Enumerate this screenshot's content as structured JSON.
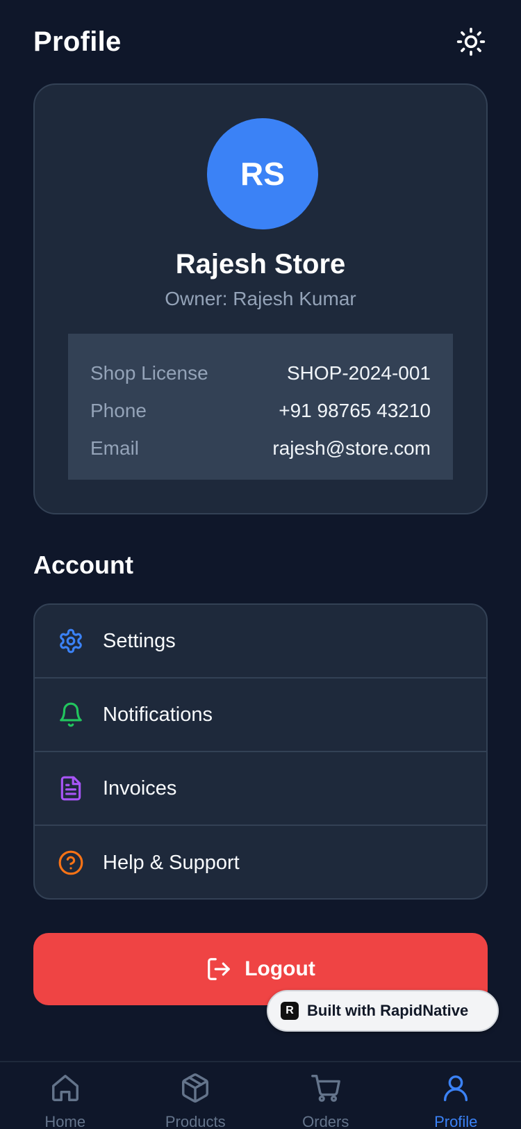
{
  "header": {
    "title": "Profile",
    "theme_icon": "sun-icon"
  },
  "profile": {
    "initials": "RS",
    "store_name": "Rajesh Store",
    "owner": "Owner: Rajesh Kumar",
    "details": [
      {
        "label": "Shop License",
        "value": "SHOP-2024-001"
      },
      {
        "label": "Phone",
        "value": "+91 98765 43210"
      },
      {
        "label": "Email",
        "value": "rajesh@store.com"
      }
    ]
  },
  "account": {
    "title": "Account",
    "items": [
      {
        "label": "Settings",
        "icon": "gear-icon",
        "color": "#3b82f6"
      },
      {
        "label": "Notifications",
        "icon": "bell-icon",
        "color": "#22c55e"
      },
      {
        "label": "Invoices",
        "icon": "document-icon",
        "color": "#a855f7"
      },
      {
        "label": "Help & Support",
        "icon": "help-circle-icon",
        "color": "#f97316"
      }
    ]
  },
  "logout": {
    "label": "Logout",
    "icon": "logout-icon"
  },
  "badge": {
    "label": "Built with RapidNative"
  },
  "bottom_nav": {
    "items": [
      {
        "label": "Home",
        "icon": "home-icon",
        "active": false
      },
      {
        "label": "Products",
        "icon": "box-icon",
        "active": false
      },
      {
        "label": "Orders",
        "icon": "cart-icon",
        "active": false
      },
      {
        "label": "Profile",
        "icon": "user-icon",
        "active": true
      }
    ]
  },
  "colors": {
    "background": "#0f172a",
    "card": "#1e293b",
    "accent": "#3b82f6",
    "danger": "#ef4444",
    "muted": "#94a3b8"
  }
}
